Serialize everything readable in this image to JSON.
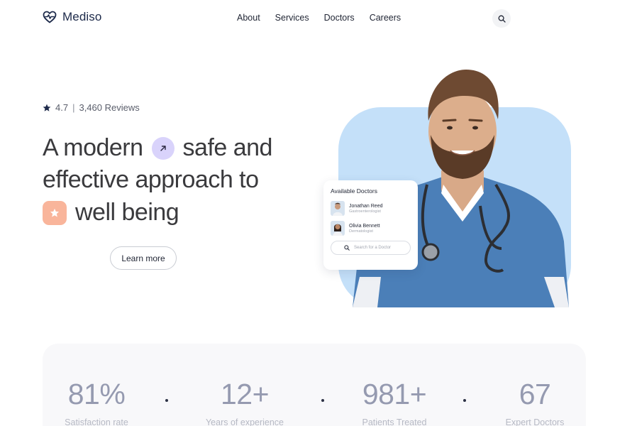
{
  "brand": {
    "name": "Mediso",
    "logo_icon": "heart-pulse-icon",
    "color": "#1d2a4a"
  },
  "nav": {
    "items": [
      "About",
      "Services",
      "Doctors",
      "Careers"
    ],
    "search_icon": "search-icon"
  },
  "hero": {
    "rating": {
      "score": "4.7",
      "separator": "|",
      "reviews": "3,460 Reviews"
    },
    "headline": {
      "line1_a": "A modern",
      "line1_b": "safe and",
      "line2": "effective approach to",
      "line3": "well being"
    },
    "cta_label": "Learn more",
    "accent_purple": "#d9d3fb",
    "accent_peach": "#f9b59b",
    "photo_bg": "#c4e0f9"
  },
  "doctors_panel": {
    "title": "Available Doctors",
    "doctors": [
      {
        "name": "Jonathan Reed",
        "specialty": "Gastroenterologist"
      },
      {
        "name": "Olivia Bennett",
        "specialty": "Dermatologist"
      }
    ],
    "search_placeholder": "Search for a Doctor"
  },
  "stats": [
    {
      "value": "81%",
      "label": "Satisfaction rate"
    },
    {
      "value": "12+",
      "label": "Years of experience"
    },
    {
      "value": "981+",
      "label": "Patients Treated"
    },
    {
      "value": "67",
      "label": "Expert Doctors"
    }
  ]
}
